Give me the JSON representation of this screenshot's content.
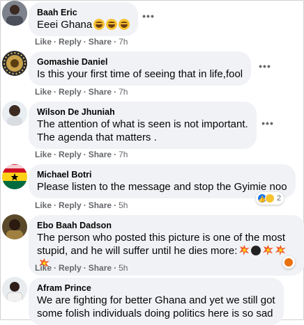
{
  "comments": [
    {
      "name": "Baah Eric",
      "text": "Eeei Ghana",
      "emojis": [
        "laughing-crying-emoji",
        "laughing-crying-emoji",
        "laughing-crying-emoji"
      ],
      "actions": {
        "like": "Like",
        "reply": "Reply",
        "share": "Share",
        "time": "7h"
      }
    },
    {
      "name": "Gomashie Daniel",
      "text": "Is this your first time of seeing that in life,fool",
      "actions": {
        "like": "Like",
        "reply": "Reply",
        "share": "Share",
        "time": "7h"
      }
    },
    {
      "name": "Wilson De Jhuniah",
      "text": "The attention of what is seen is not important.\nThe agenda that matters .",
      "actions": {
        "like": "Like",
        "reply": "Reply",
        "share": "Share",
        "time": "7h"
      }
    },
    {
      "name": "Michael Botri",
      "text": "Please listen to the message and stop the Gyimie noo",
      "reactions": {
        "icons": [
          "like-icon",
          "haha-icon"
        ],
        "count": "2"
      },
      "actions": {
        "like": "Like",
        "reply": "Reply",
        "share": "Share",
        "time": "5h"
      }
    },
    {
      "name": "Ebo Baah Dadson",
      "text": "The person who posted this picture is one of the most\nstupid, and he will suffer until he dies more:",
      "emojis": [
        "collision-emoji",
        "bomb-emoji",
        "collision-emoji",
        "collision-emoji",
        "collision-emoji"
      ],
      "reactions": {
        "icons": [
          "angry-icon"
        ],
        "count": ""
      },
      "actions": {
        "like": "Like",
        "reply": "Reply",
        "share": "Share",
        "time": "5h"
      }
    },
    {
      "name": "Afram Prince",
      "text": "We are fighting for better Ghana and yet we still got\nsome folish individuals doing politics here is so sad",
      "actions": {}
    }
  ],
  "more_icon": "•••",
  "colors": {
    "bubble": "#f0f2f5",
    "like_blue": "#1877f2",
    "angry_orange": "#e9710f",
    "haha_yellow": "#f7c331"
  }
}
